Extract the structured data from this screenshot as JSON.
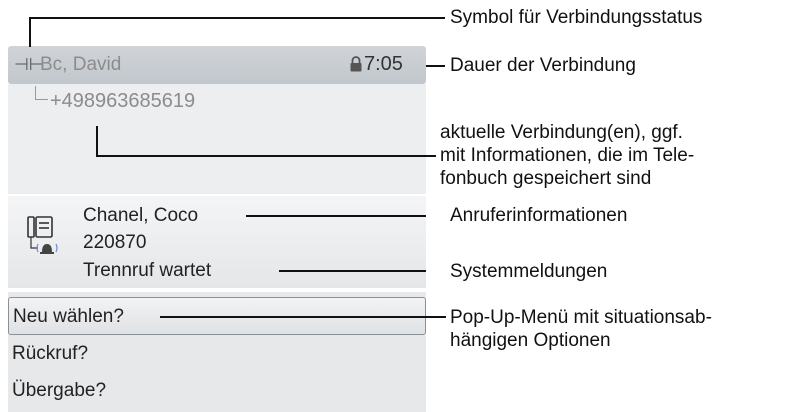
{
  "display": {
    "header": {
      "status_symbol": "⊣⊢",
      "name": "Bc, David",
      "time": "7:05",
      "lock_icon": "lock-icon"
    },
    "number": "+498963685619",
    "caller": {
      "name": "Chanel, Coco",
      "number": "220870",
      "message": "Trennruf wartet",
      "icon": "phone-ringing-icon"
    },
    "menu": [
      {
        "label": "Neu wählen?",
        "selected": true
      },
      {
        "label": "Rückruf?",
        "selected": false
      },
      {
        "label": "Übergabe?",
        "selected": false
      }
    ]
  },
  "annotations": {
    "status_symbol": "Symbol für Verbindungsstatus",
    "duration": "Dauer der Verbindung",
    "connection_1": "aktuelle Verbindung(en), ggf.",
    "connection_2": "mit Informationen, die im Tele-",
    "connection_3": "fonbuch gespeichert sind",
    "caller_info": "Anruferinformationen",
    "system_msg": "Systemmeldungen",
    "popup_1": "Pop-Up-Menü mit situationsab-",
    "popup_2": "hängigen Optionen"
  }
}
